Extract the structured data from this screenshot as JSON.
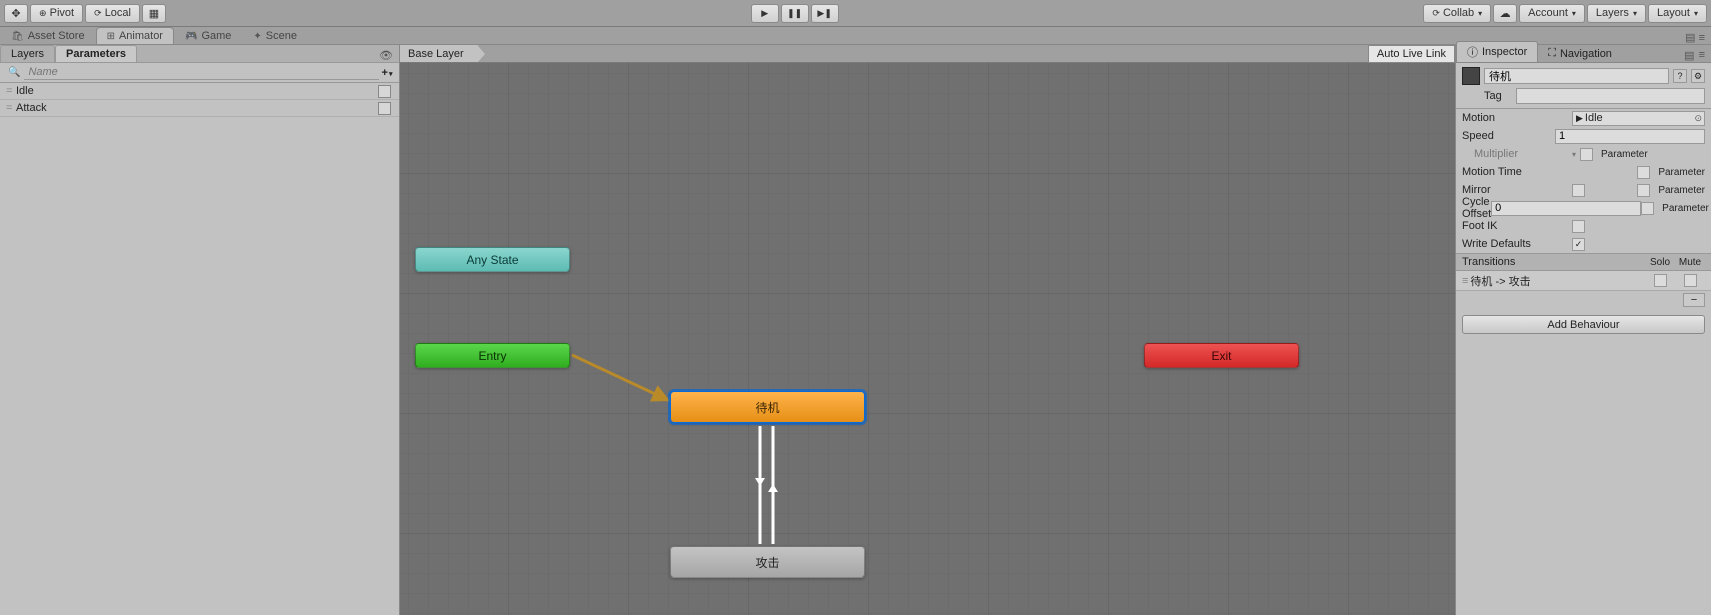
{
  "toolbar": {
    "pivot_label": "Pivot",
    "local_label": "Local",
    "collab_label": "Collab",
    "account_label": "Account",
    "layers_label": "Layers",
    "layout_label": "Layout"
  },
  "tabs": {
    "asset_store": "Asset Store",
    "animator": "Animator",
    "game": "Game",
    "scene": "Scene"
  },
  "left": {
    "tab_layers": "Layers",
    "tab_params": "Parameters",
    "search_placeholder": "Name",
    "params": [
      {
        "name": "Idle"
      },
      {
        "name": "Attack"
      }
    ]
  },
  "center": {
    "breadcrumb": "Base Layer",
    "auto_live": "Auto Live Link",
    "nodes": {
      "anystate": "Any State",
      "entry": "Entry",
      "exit": "Exit",
      "idle": "待机",
      "attack": "攻击"
    }
  },
  "inspector": {
    "tab_inspector": "Inspector",
    "tab_navigation": "Navigation",
    "state_name": "待机",
    "tag_label": "Tag",
    "tag_value": "",
    "motion_label": "Motion",
    "motion_value": "Idle",
    "speed_label": "Speed",
    "speed_value": "1",
    "multiplier_label": "Multiplier",
    "parameter_label": "Parameter",
    "motion_time_label": "Motion Time",
    "mirror_label": "Mirror",
    "cycle_offset_label": "Cycle Offset",
    "cycle_offset_value": "0",
    "foot_ik_label": "Foot IK",
    "write_defaults_label": "Write Defaults",
    "transitions_label": "Transitions",
    "solo_label": "Solo",
    "mute_label": "Mute",
    "transition_name": "待机 -> 攻击",
    "add_behaviour": "Add Behaviour"
  }
}
